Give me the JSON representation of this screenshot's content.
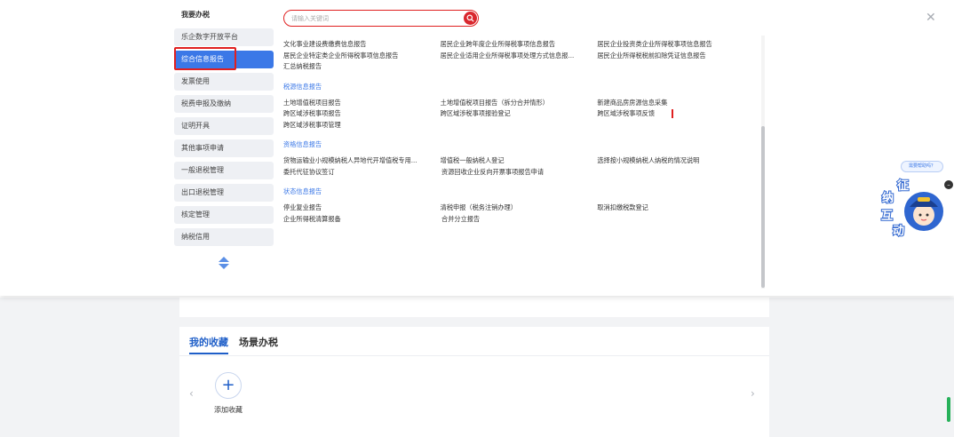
{
  "background": {
    "tabs": [
      "我的收藏",
      "场景办税"
    ],
    "add_label": "添加收藏",
    "add_icon": "plus-icon",
    "prev_icon": "chevron-left-icon",
    "next_icon": "chevron-right-icon"
  },
  "panel": {
    "close_icon": "close-icon",
    "search": {
      "placeholder": "请输入关键词",
      "value": "",
      "icon": "search-icon"
    },
    "sidebar": {
      "title": "我要办税",
      "items": [
        "乐企数字开放平台",
        "综合信息报告",
        "发票使用",
        "税费申报及缴纳",
        "证明开具",
        "其他事项申请",
        "一般退税管理",
        "出口退税管理",
        "核定管理",
        "纳税信用"
      ],
      "active_index": 1,
      "scroll_icon": "scroll-up-down-icon"
    },
    "top_rows": [
      [
        "文化事业建设费缴费信息报告",
        "居民企业跨年度企业所得税事项信息报告",
        "居民企业投资类企业所得税事项信息报告"
      ],
      [
        "居民企业特定类企业所得税事项信息报告",
        "居民企业适用企业所得税事项处理方式信息报...",
        "居民企业所得税税前扣除凭证信息报告"
      ],
      [
        "汇总纳税报告",
        "",
        ""
      ]
    ],
    "sections": [
      {
        "title": "税源信息报告",
        "rows": [
          [
            "土地增值税项目报告",
            "土地增值税项目报告（拆分合并情形）",
            "新建商品房房源信息采集"
          ],
          [
            "跨区域涉税事项报告",
            "跨区域涉税事项报验登记",
            "跨区域涉税事项反馈"
          ],
          [
            "跨区域涉税事项管理",
            "",
            ""
          ]
        ]
      },
      {
        "title": "资格信息报告",
        "rows": [
          [
            "货物运输业小规模纳税人异地代开增值税专用...",
            "增值税一般纳税人登记",
            "选择按小规模纳税人纳税的情况说明"
          ],
          [
            "委托代征协议签订",
            "资源回收企业反向开票事项报告申请",
            ""
          ]
        ]
      },
      {
        "title": "状态信息报告",
        "rows": [
          [
            "停业复业报告",
            "清税申报（税务注销办理）",
            "取消扣缴税款登记"
          ],
          [
            "企业所得税清算报备",
            "合并分立报告",
            ""
          ]
        ]
      }
    ]
  },
  "assistant": {
    "bubble": "需要帮助吗？",
    "mascot_text": [
      "征",
      "纳",
      "互",
      "动"
    ],
    "mascot_icon": "service-mascot-icon",
    "close_icon": "close-icon"
  }
}
